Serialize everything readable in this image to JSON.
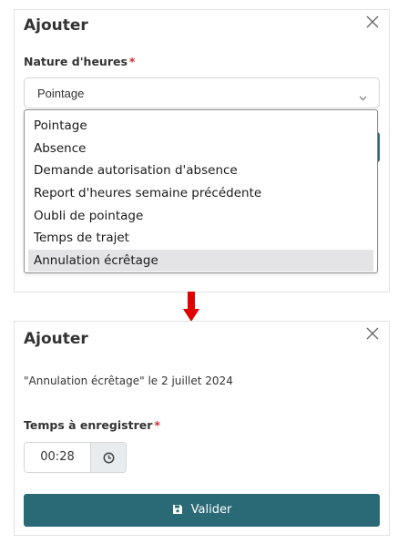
{
  "screen1": {
    "dialog_title": "Ajouter",
    "field_label": "Nature d'heures",
    "required_mark": "*",
    "select_value": "Pointage",
    "options": [
      "Pointage",
      "Absence",
      "Demande autorisation d'absence",
      "Report d'heures semaine précédente",
      "Oubli de pointage",
      "Temps de trajet",
      "Annulation écrêtage"
    ],
    "highlighted_option": "Annulation écrêtage"
  },
  "screen2": {
    "dialog_title": "Ajouter",
    "summary": "\"Annulation écrêtage\" le 2 juillet 2024",
    "field_label": "Temps à enregistrer",
    "required_mark": "*",
    "time_value": "00:28",
    "submit_label": "Valider"
  },
  "icons": {
    "close": "close-icon",
    "chevron": "chevron-down-icon",
    "clock": "clock-icon",
    "save": "save-icon",
    "arrow": "arrow-down-icon"
  },
  "colors": {
    "accent": "#2a6a76",
    "required": "#d32f2f",
    "arrow": "#e00000",
    "highlight": "#e4e4e6"
  }
}
